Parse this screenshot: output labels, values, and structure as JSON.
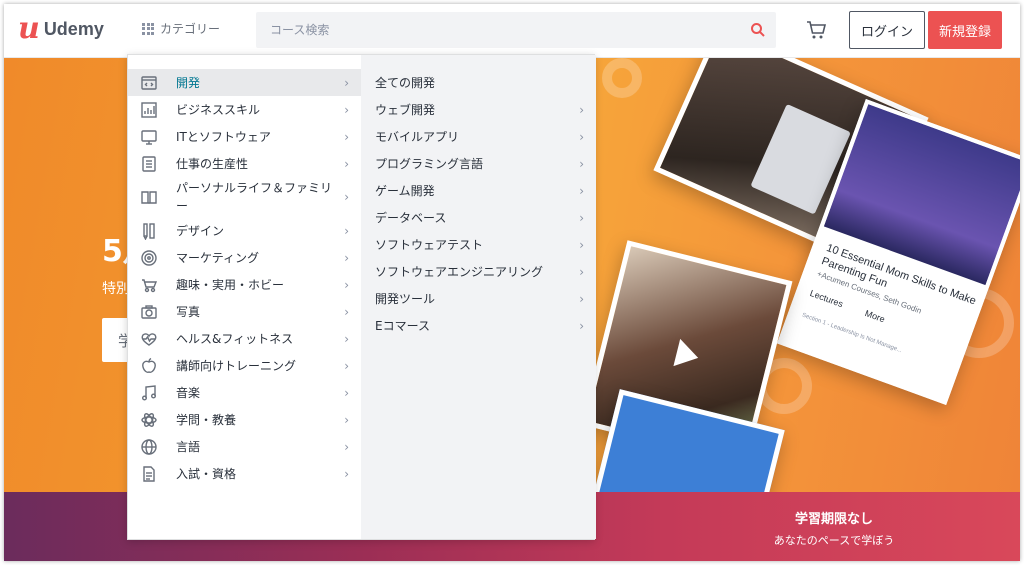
{
  "header": {
    "logo_text": "Udemy",
    "category_label": "カテゴリー",
    "search_placeholder": "コース検索",
    "login_label": "ログイン",
    "signup_label": "新規登録",
    "accent_color": "#ec5252"
  },
  "hero": {
    "title_fragment": "5月",
    "subtitle_fragment": "特別",
    "input_fragment": "学",
    "card_title": "10 Essential Mom Skills to Make Parenting Fun",
    "card_authors": "+Acumen Courses, Seth Godin",
    "card_tab_lectures": "Lectures",
    "card_tab_more": "More",
    "card_section": "Section 1 - Leadership Is Not Manage..."
  },
  "band": {
    "title": "学習期限なし",
    "subtitle": "あなたのペースで学ぼう"
  },
  "menu": {
    "categories": [
      {
        "label": "開発",
        "icon": "code-icon"
      },
      {
        "label": "ビジネススキル",
        "icon": "chart-icon"
      },
      {
        "label": "ITとソフトウェア",
        "icon": "monitor-icon"
      },
      {
        "label": "仕事の生産性",
        "icon": "checklist-icon"
      },
      {
        "label": "パーソナルライフ＆ファミリー",
        "icon": "book-icon"
      },
      {
        "label": "デザイン",
        "icon": "pencil-icon"
      },
      {
        "label": "マーケティング",
        "icon": "target-icon"
      },
      {
        "label": "趣味・実用・ホビー",
        "icon": "stroller-icon"
      },
      {
        "label": "写真",
        "icon": "camera-icon"
      },
      {
        "label": "ヘルス&フィットネス",
        "icon": "heart-pulse-icon"
      },
      {
        "label": "講師向けトレーニング",
        "icon": "apple-icon"
      },
      {
        "label": "音楽",
        "icon": "music-note-icon"
      },
      {
        "label": "学問・教養",
        "icon": "atom-icon"
      },
      {
        "label": "言語",
        "icon": "globe-icon"
      },
      {
        "label": "入試・資格",
        "icon": "document-icon"
      }
    ],
    "subcategories": [
      {
        "label": "全ての開発",
        "chevron": false
      },
      {
        "label": "ウェブ開発",
        "chevron": true
      },
      {
        "label": "モバイルアプリ",
        "chevron": true
      },
      {
        "label": "プログラミング言語",
        "chevron": true
      },
      {
        "label": "ゲーム開発",
        "chevron": true
      },
      {
        "label": "データベース",
        "chevron": true
      },
      {
        "label": "ソフトウェアテスト",
        "chevron": true
      },
      {
        "label": "ソフトウェアエンジニアリング",
        "chevron": true
      },
      {
        "label": "開発ツール",
        "chevron": true
      },
      {
        "label": "Eコマース",
        "chevron": true
      }
    ],
    "chevron_glyph": "›"
  }
}
